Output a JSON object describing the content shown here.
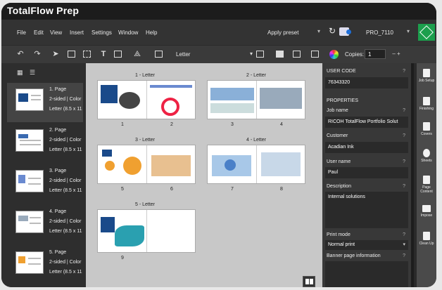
{
  "app": {
    "title": "TotalFlow Prep"
  },
  "menu": [
    "File",
    "Edit",
    "View",
    "Insert",
    "Settings",
    "Window",
    "Help"
  ],
  "header": {
    "preset_label": "Apply preset",
    "printer_name": "PRO_7110"
  },
  "toolbar": {
    "paper_size": "Letter",
    "copies_label": "Copies:",
    "copies_value": "1",
    "copies_step": "– +"
  },
  "jobs": [
    {
      "title": "1. Page",
      "sides": "2-sided | Color",
      "size": "Letter (8.5 x 11"
    },
    {
      "title": "2. Page",
      "sides": "2-sided | Color",
      "size": "Letter (8.5 x 11"
    },
    {
      "title": "3. Page",
      "sides": "2-sided | Color",
      "size": "Letter (8.5 x 11"
    },
    {
      "title": "4. Page",
      "sides": "2-sided | Color",
      "size": "Letter (8.5 x 11"
    },
    {
      "title": "5. Page",
      "sides": "2-sided | Color",
      "size": "Letter (8.5 x 11"
    }
  ],
  "spreads": [
    {
      "label": "1 - Letter",
      "left_page": "1",
      "right_page": "2"
    },
    {
      "label": "2 - Letter",
      "left_page": "3",
      "right_page": "4"
    },
    {
      "label": "3 - Letter",
      "left_page": "5",
      "right_page": "6"
    },
    {
      "label": "4 - Letter",
      "left_page": "7",
      "right_page": "8"
    },
    {
      "label": "5 - Letter",
      "left_page": "9",
      "right_page": ""
    }
  ],
  "properties": {
    "user_code_label": "USER CODE",
    "user_code": "76343320",
    "section": "PROPERTIES",
    "job_name_label": "Job name",
    "job_name": "RICOH TotalFlow Portfolio Solut",
    "customer_label": "Customer",
    "customer": "Acadian Ink",
    "user_name_label": "User name",
    "user_name": "Paul",
    "description_label": "Description",
    "description": "Internal solutions",
    "print_mode_label": "Print mode",
    "print_mode": "Normal print",
    "banner_label": "Banner page information",
    "help": "?"
  },
  "sidebar": [
    {
      "label": "Job Setup",
      "icon": "document-icon"
    },
    {
      "label": "Finishing",
      "icon": "staple-icon"
    },
    {
      "label": "Covers",
      "icon": "cover-icon"
    },
    {
      "label": "Sheets",
      "icon": "stack-icon"
    },
    {
      "label": "Page Content",
      "icon": "page-icon"
    },
    {
      "label": "Impose",
      "icon": "grid-icon"
    },
    {
      "label": "Clean Up",
      "icon": "cleanup-icon"
    }
  ],
  "colors": {
    "accent_green": "#1c9f4d",
    "brand_blue": "#1a4a8a",
    "panel_dark": "#2a2a2a"
  }
}
